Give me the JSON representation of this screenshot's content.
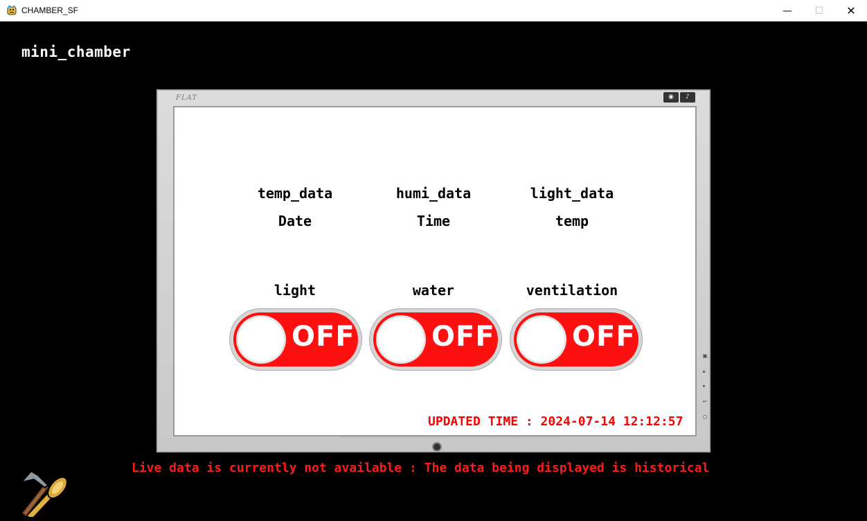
{
  "window": {
    "title": "CHAMBER_SF",
    "minimize_glyph": "—",
    "maximize_glyph": "☐",
    "close_glyph": "✕"
  },
  "app": {
    "heading": "mini_chamber"
  },
  "monitor": {
    "brand": "FLAT"
  },
  "sensors": {
    "temp_label": "temp_data",
    "humi_label": "humi_data",
    "light_label": "light_data",
    "date_label": "Date",
    "time_label": "Time",
    "temp_value_label": "temp"
  },
  "controls": [
    {
      "label": "light",
      "state": "OFF"
    },
    {
      "label": "water",
      "state": "OFF"
    },
    {
      "label": "ventilation",
      "state": "OFF"
    }
  ],
  "status": {
    "updated": "UPDATED TIME : 2024-07-14 12:12:57",
    "notice": "Live data is currently not available : The data being displayed is historical"
  },
  "colors": {
    "toggle_off": "#ff1010",
    "status_text": "#ff0000",
    "background": "#000000"
  },
  "icons": [
    "app-icon",
    "pickaxe-icon",
    "hammer-icon"
  ]
}
